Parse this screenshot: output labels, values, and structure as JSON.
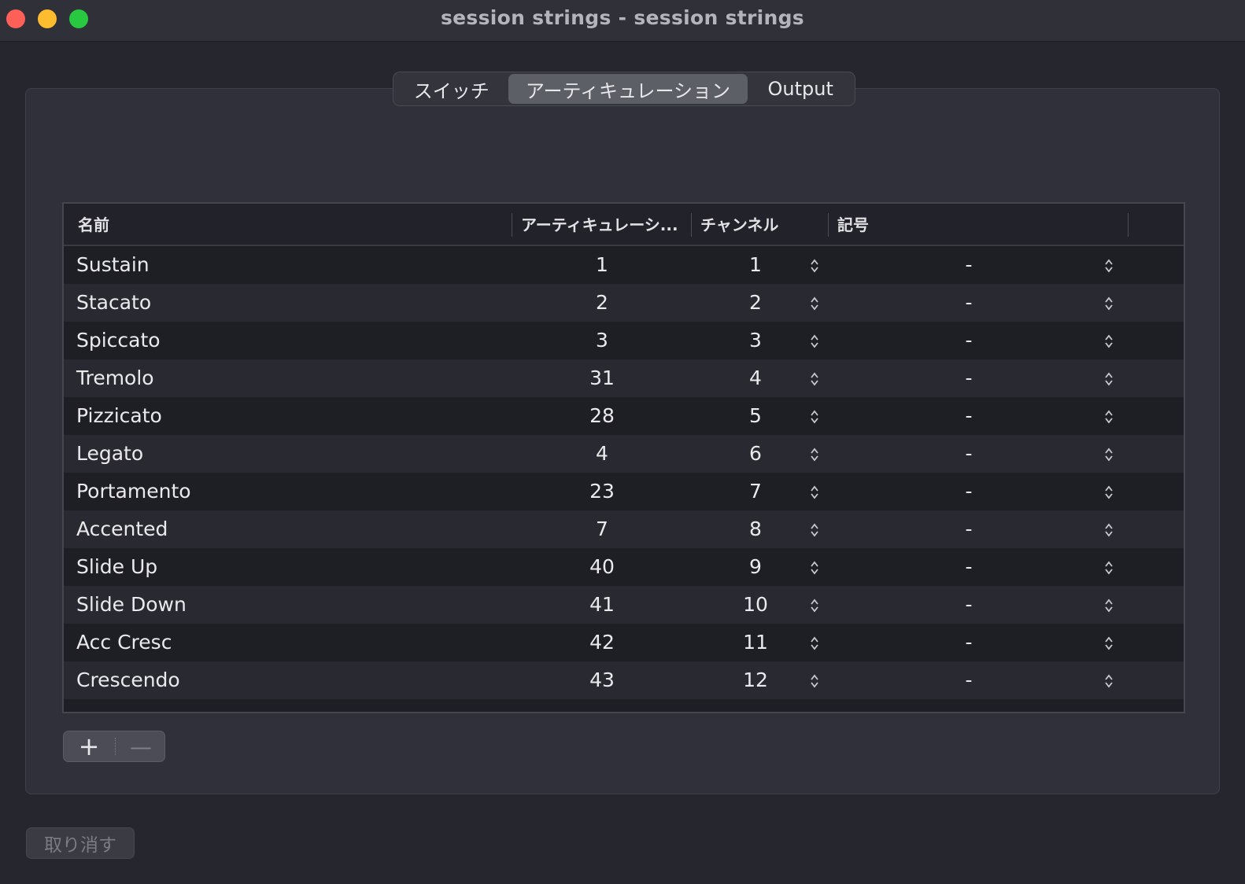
{
  "window": {
    "title": "session strings - session strings"
  },
  "tabs": [
    {
      "label": "スイッチ",
      "selected": false
    },
    {
      "label": "アーティキュレーション",
      "selected": true
    },
    {
      "label": "Output",
      "selected": false
    }
  ],
  "table": {
    "headers": {
      "name": "名前",
      "articulation": "アーティキュレーシ...",
      "channel": "チャンネル",
      "symbol": "記号"
    },
    "rows": [
      {
        "name": "Sustain",
        "articulation": "1",
        "channel": "1",
        "symbol": "-"
      },
      {
        "name": "Stacato",
        "articulation": "2",
        "channel": "2",
        "symbol": "-"
      },
      {
        "name": "Spiccato",
        "articulation": "3",
        "channel": "3",
        "symbol": "-"
      },
      {
        "name": "Tremolo",
        "articulation": "31",
        "channel": "4",
        "symbol": "-"
      },
      {
        "name": "Pizzicato",
        "articulation": "28",
        "channel": "5",
        "symbol": "-"
      },
      {
        "name": "Legato",
        "articulation": "4",
        "channel": "6",
        "symbol": "-"
      },
      {
        "name": "Portamento",
        "articulation": "23",
        "channel": "7",
        "symbol": "-"
      },
      {
        "name": "Accented",
        "articulation": "7",
        "channel": "8",
        "symbol": "-"
      },
      {
        "name": "Slide Up",
        "articulation": "40",
        "channel": "9",
        "symbol": "-"
      },
      {
        "name": "Slide Down",
        "articulation": "41",
        "channel": "10",
        "symbol": "-"
      },
      {
        "name": "Acc Cresc",
        "articulation": "42",
        "channel": "11",
        "symbol": "-"
      },
      {
        "name": "Crescendo",
        "articulation": "43",
        "channel": "12",
        "symbol": "-"
      }
    ]
  },
  "buttons": {
    "add": "+",
    "remove": "—",
    "undo": "取り消す"
  },
  "colors": {
    "close": "#fe5f57",
    "minimize": "#febc2e",
    "maximize": "#28c840",
    "selected_tab": "#5d5f67"
  }
}
